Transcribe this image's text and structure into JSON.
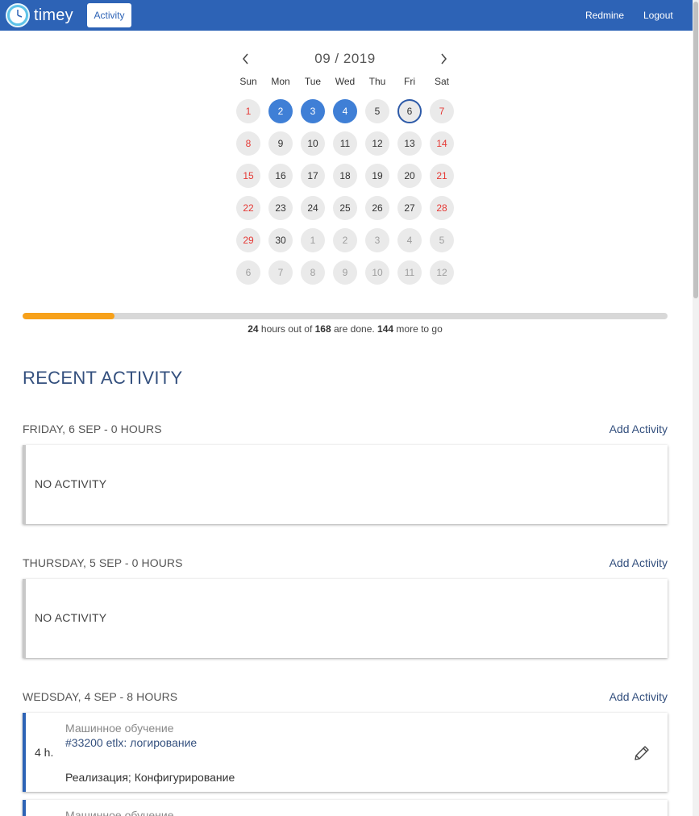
{
  "header": {
    "app_name": "timey",
    "nav_activity": "Activity",
    "nav_redmine": "Redmine",
    "nav_logout": "Logout",
    "brand_color": "#2d63b6"
  },
  "calendar": {
    "title": "09 / 2019",
    "weekdays": [
      "Sun",
      "Mon",
      "Tue",
      "Wed",
      "Thu",
      "Fri",
      "Sat"
    ],
    "days": [
      {
        "n": "1",
        "state": "weekend"
      },
      {
        "n": "2",
        "state": "selected"
      },
      {
        "n": "3",
        "state": "selected"
      },
      {
        "n": "4",
        "state": "selected"
      },
      {
        "n": "5",
        "state": "normal"
      },
      {
        "n": "6",
        "state": "today"
      },
      {
        "n": "7",
        "state": "weekend"
      },
      {
        "n": "8",
        "state": "weekend"
      },
      {
        "n": "9",
        "state": "normal"
      },
      {
        "n": "10",
        "state": "normal"
      },
      {
        "n": "11",
        "state": "normal"
      },
      {
        "n": "12",
        "state": "normal"
      },
      {
        "n": "13",
        "state": "normal"
      },
      {
        "n": "14",
        "state": "weekend"
      },
      {
        "n": "15",
        "state": "weekend"
      },
      {
        "n": "16",
        "state": "normal"
      },
      {
        "n": "17",
        "state": "normal"
      },
      {
        "n": "18",
        "state": "normal"
      },
      {
        "n": "19",
        "state": "normal"
      },
      {
        "n": "20",
        "state": "normal"
      },
      {
        "n": "21",
        "state": "weekend"
      },
      {
        "n": "22",
        "state": "weekend"
      },
      {
        "n": "23",
        "state": "normal"
      },
      {
        "n": "24",
        "state": "normal"
      },
      {
        "n": "25",
        "state": "normal"
      },
      {
        "n": "26",
        "state": "normal"
      },
      {
        "n": "27",
        "state": "normal"
      },
      {
        "n": "28",
        "state": "weekend"
      },
      {
        "n": "29",
        "state": "weekend"
      },
      {
        "n": "30",
        "state": "normal"
      },
      {
        "n": "1",
        "state": "other"
      },
      {
        "n": "2",
        "state": "other"
      },
      {
        "n": "3",
        "state": "other"
      },
      {
        "n": "4",
        "state": "other"
      },
      {
        "n": "5",
        "state": "other"
      },
      {
        "n": "6",
        "state": "other"
      },
      {
        "n": "7",
        "state": "other"
      },
      {
        "n": "8",
        "state": "other"
      },
      {
        "n": "9",
        "state": "other"
      },
      {
        "n": "10",
        "state": "other"
      },
      {
        "n": "11",
        "state": "other"
      },
      {
        "n": "12",
        "state": "other"
      }
    ]
  },
  "progress": {
    "done": "24",
    "total": "168",
    "remaining": "144",
    "text_hours_out_of": " hours out of ",
    "text_are_done": " are done. ",
    "text_more_to_go": " more to go",
    "fraction": 0.1429
  },
  "recent": {
    "title": "RECENT ACTIVITY",
    "add_label": "Add Activity",
    "no_activity_label": "NO ACTIVITY",
    "days": [
      {
        "label": "FRIDAY, 6 SEP - 0 HOURS"
      },
      {
        "label": "THURSDAY, 5 SEP - 0 HOURS"
      },
      {
        "label": "WEDSDAY, 4 SEP - 8 HOURS"
      }
    ],
    "entries": [
      {
        "hours": "4 h.",
        "project": "Машинное обучение",
        "issue": "#33200 etlx: логирование",
        "activity": "Реализация; Конфигурирование"
      },
      {
        "project": "Машинное обучение"
      }
    ]
  }
}
